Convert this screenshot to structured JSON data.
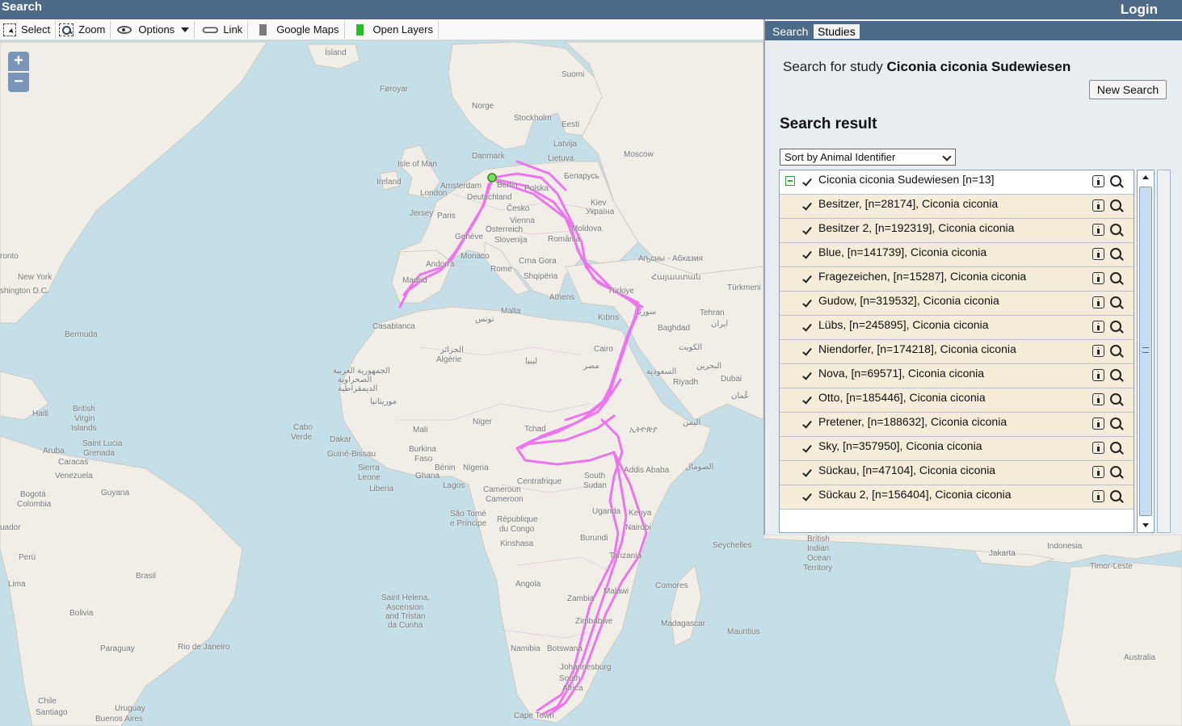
{
  "app": {
    "title": "Search",
    "login_label": "Login"
  },
  "toolbar": {
    "items": [
      {
        "label": "Select",
        "icon": "select-icon"
      },
      {
        "label": "Zoom",
        "icon": "zoom-box-icon"
      },
      {
        "label": "Options",
        "icon": "eye-icon"
      },
      {
        "label": "Link",
        "icon": "link-icon"
      },
      {
        "label": "Google Maps",
        "icon": "gray-layer-icon"
      },
      {
        "label": "Open Layers",
        "icon": "green-layer-icon"
      }
    ]
  },
  "map": {
    "zoom_in": "+",
    "zoom_out": "−",
    "track_color": "#ee6ef0",
    "labels": {
      "island": "Ísland",
      "foroyar": "Føroyar",
      "norge": "Norge",
      "suomi": "Suomi",
      "stockholm": "Stockholm",
      "eesti": "Eesti",
      "latvija": "Latvija",
      "lietuva": "Lietuva",
      "danmark": "Danmark",
      "moscow": "Moscow",
      "isle_of_man": "Isle of Man",
      "ireland": "Ireland",
      "london": "London",
      "amsterdam": "Amsterdam",
      "berlin": "Berlin",
      "polska": "Polska",
      "belarus": "Беларусь",
      "deutschland": "Deutschland",
      "kiev": "Kiev",
      "ukraina": "Україна",
      "jersey": "Jersey",
      "paris": "Paris",
      "cesko": "Česko",
      "vienna": "Vienna",
      "moldova": "Moldova",
      "osterreich": "Österreich",
      "geneve": "Genève",
      "slovenija": "Slovenija",
      "romania": "România",
      "monaco": "Monaco",
      "andorra": "Andorra",
      "madrid": "Madrid",
      "rome": "Rome",
      "crna_gora": "Crna Gora",
      "shqiperia": "Shqipëria",
      "athens": "Athens",
      "turkiye": "Türkiye",
      "abkhazia": "Аҧсны - Абхазия",
      "armenia": "Հայաստան",
      "turkmeni": "Türkmeni",
      "tehran": "Tehran",
      "iran": "ایران",
      "baghdad": "Baghdad",
      "suriya": "سوريا",
      "kibris": "Kıbrıs",
      "malta": "Malta",
      "tunis": "تونس",
      "casablanca": "Casablanca",
      "new_york": "New York",
      "washington": "shington D.C.",
      "toronto": "ronto",
      "bermuda": "Bermuda",
      "algerie_ar": "الجزائر",
      "algerie": "Algérie",
      "libya": "ليبيا",
      "cairo": "Cairo",
      "misr": "مصر",
      "kuwait": "الكويت",
      "saudi": "السعودية",
      "riyadh": "Riyadh",
      "bahrain": "البحرين",
      "dubai": "Dubai",
      "oman": "عُمان",
      "western_sahara_1": "الجمهورية العربية",
      "western_sahara_2": "الصحراوية",
      "western_sahara_3": "الديمقراطية",
      "mauritania": "موريتانيا",
      "mali": "Mali",
      "niger": "Niger",
      "tchad": "Tchad",
      "ethiopia": "ኢትዮጵያ",
      "yemen": "اليمن",
      "haiti": "Haiti",
      "british_virgin_1": "British",
      "british_virgin_2": "Virgin",
      "british_virgin_3": "Islands",
      "cabo_1": "Cabo",
      "cabo_2": "Verde",
      "dakar": "Dakar",
      "guinee_bissau": "Guiné-Bissau",
      "burkina_1": "Burkina",
      "burkina_2": "Faso",
      "nigeria": "Nigeria",
      "benin": "Bénin",
      "sierra_1": "Sierra",
      "sierra_2": "Leone",
      "liberia": "Liberia",
      "ghana": "Ghana",
      "lagos": "Lagos",
      "centrafrique": "Centrafrique",
      "south_sudan_1": "South",
      "south_sudan_2": "Sudan",
      "addis": "Addis Ababa",
      "somalia": "الصومال",
      "aruba": "Aruba",
      "saint_lucia": "Saint Lucia",
      "grenada": "Grenada",
      "caracas": "Caracas",
      "venezuela": "Venezuela",
      "guyana": "Guyana",
      "cameroun": "Cameroun",
      "cameroon": "Cameroon",
      "bogota": "Bogotá",
      "colombia": "Colombia",
      "sao_tome_1": "São Tomé",
      "sao_tome_2": "e Príncipe",
      "rep_congo_1": "République",
      "rep_congo_2": "du Congo",
      "kinshasa": "Kinshasa",
      "uganda": "Uganda",
      "kenya": "Kenya",
      "nairobi": "Nairobi",
      "burundi": "Burundi",
      "tanzania": "Tanzania",
      "ecuador": "uador",
      "peru": "Perú",
      "lima": "Lima",
      "brasil": "Brasil",
      "angola": "Angola",
      "zambia": "Zambia",
      "malawi": "Malawi",
      "comores": "Comores",
      "seychelles": "Seychelles",
      "madagascar": "Madagascar",
      "mauritius": "Mauritius",
      "zimbabwe": "Zimbabwe",
      "st_helena_1": "Saint Helena,",
      "st_helena_2": "Ascension",
      "st_helena_3": "and Tristan",
      "st_helena_4": "da Cunha",
      "bolivia": "Bolivia",
      "paraguay": "Paraguay",
      "rio": "Rio de Janeiro",
      "namibia": "Namibia",
      "botswana": "Botswana",
      "johannesburg": "Johannesburg",
      "south_africa_1": "South",
      "south_africa_2": "Africa",
      "cape_town": "Cape Town",
      "chile": "Chile",
      "santiago": "Santiago",
      "uruguay": "Uruguay",
      "buenos_aires": "Buenos Aires",
      "biot_1": "British",
      "biot_2": "Indian",
      "biot_3": "Ocean",
      "biot_4": "Territory",
      "jakarta": "Jakarta",
      "indonesia": "Indonesia",
      "timor": "Timor-Leste",
      "australia": "Australia"
    }
  },
  "panel": {
    "tabs": [
      {
        "label": "Search",
        "active": false
      },
      {
        "label": "Studies",
        "active": true
      }
    ],
    "search_prefix": "Search for study ",
    "study_name": "Ciconia ciconia Sudewiesen",
    "new_search_label": "New Search",
    "result_heading": "Search result",
    "sort_selected": "Sort by Animal Identifier",
    "study_row": "Ciconia ciconia Sudewiesen [n=13]",
    "animals": [
      "Besitzer, [n=28174], Ciconia ciconia",
      "Besitzer 2, [n=192319], Ciconia ciconia",
      "Blue, [n=141739], Ciconia ciconia",
      "Fragezeichen, [n=15287], Ciconia ciconia",
      "Gudow, [n=319532], Ciconia ciconia",
      "Lübs, [n=245895], Ciconia ciconia",
      "Niendorfer, [n=174218], Ciconia ciconia",
      "Nova, [n=69571], Ciconia ciconia",
      "Otto, [n=185446], Ciconia ciconia",
      "Pretener, [n=188632], Ciconia ciconia",
      "Sky, [n=357950], Ciconia ciconia",
      "Sückau, [n=47104], Ciconia ciconia",
      "Sückau 2, [n=156404], Ciconia ciconia"
    ]
  }
}
